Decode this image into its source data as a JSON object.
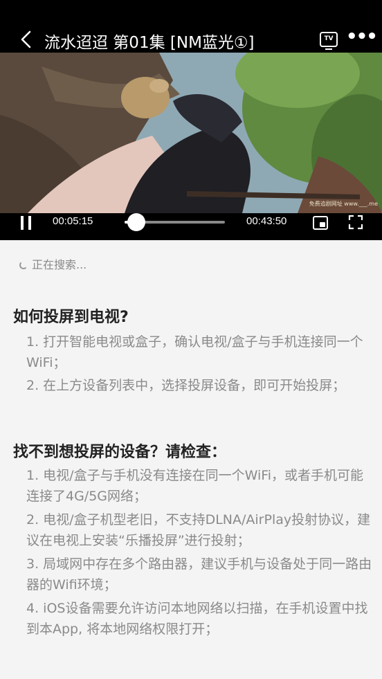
{
  "header": {
    "title": "流水迢迢 第01集 [NM蓝光①]",
    "tv_label": "TV",
    "more_label": "•••"
  },
  "video": {
    "watermark": "免费追剧网址 www.___.me"
  },
  "player": {
    "current_time": "00:05:15",
    "total_time": "00:43:50",
    "progress": 0.12
  },
  "status": {
    "searching": "正在搜索..."
  },
  "howto": {
    "heading": "如何投屏到电视?",
    "items": [
      "1. 打开智能电视或盒子，确认电视/盒子与手机连接同一个WiFi；",
      "2. 在上方设备列表中，选择投屏设备，即可开始投屏；"
    ]
  },
  "troubleshoot": {
    "heading": "找不到想投屏的设备？请检查：",
    "items": [
      "1. 电视/盒子与手机没有连接在同一个WiFi，或者手机可能连接了4G/5G网络；",
      "2. 电视/盒子机型老旧，不支持DLNA/AirPlay投射协议，建议在电视上安装“乐播投屏”进行投射；",
      "3. 局域网中存在多个路由器，建议手机与设备处于同一路由器的Wifi环境；",
      "4. iOS设备需要允许访问本地网络以扫描，在手机设置中找到本App, 将本地网络权限打开；"
    ]
  }
}
